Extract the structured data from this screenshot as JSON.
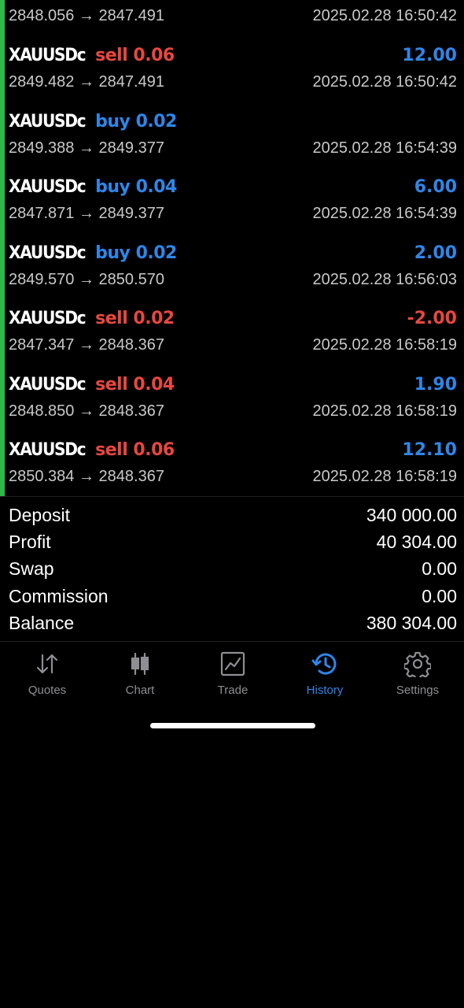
{
  "deals": [
    {
      "symbol": "",
      "side": "",
      "side_class": "",
      "volume": "",
      "profit": "",
      "profit_class": "pos",
      "open_price": "2848.056",
      "close_price": "2847.491",
      "time": "2025.02.28 16:50:42"
    },
    {
      "symbol": "XAUUSDc",
      "side": "sell",
      "side_class": "sell",
      "volume": "0.06",
      "profit": "12.00",
      "profit_class": "pos",
      "open_price": "2849.482",
      "close_price": "2847.491",
      "time": "2025.02.28 16:50:42"
    },
    {
      "symbol": "XAUUSDc",
      "side": "buy",
      "side_class": "buy",
      "volume": "0.02",
      "profit": "",
      "profit_class": "pos",
      "open_price": "2849.388",
      "close_price": "2849.377",
      "time": "2025.02.28 16:54:39"
    },
    {
      "symbol": "XAUUSDc",
      "side": "buy",
      "side_class": "buy",
      "volume": "0.04",
      "profit": "6.00",
      "profit_class": "pos",
      "open_price": "2847.871",
      "close_price": "2849.377",
      "time": "2025.02.28 16:54:39"
    },
    {
      "symbol": "XAUUSDc",
      "side": "buy",
      "side_class": "buy",
      "volume": "0.02",
      "profit": "2.00",
      "profit_class": "pos",
      "open_price": "2849.570",
      "close_price": "2850.570",
      "time": "2025.02.28 16:56:03"
    },
    {
      "symbol": "XAUUSDc",
      "side": "sell",
      "side_class": "sell",
      "volume": "0.02",
      "profit": "-2.00",
      "profit_class": "neg",
      "open_price": "2847.347",
      "close_price": "2848.367",
      "time": "2025.02.28 16:58:19"
    },
    {
      "symbol": "XAUUSDc",
      "side": "sell",
      "side_class": "sell",
      "volume": "0.04",
      "profit": "1.90",
      "profit_class": "pos",
      "open_price": "2848.850",
      "close_price": "2848.367",
      "time": "2025.02.28 16:58:19"
    },
    {
      "symbol": "XAUUSDc",
      "side": "sell",
      "side_class": "sell",
      "volume": "0.06",
      "profit": "12.10",
      "profit_class": "pos",
      "open_price": "2850.384",
      "close_price": "2848.367",
      "time": "2025.02.28 16:58:19"
    }
  ],
  "arrow": "→",
  "summary": [
    {
      "label": "Deposit",
      "value": "340 000.00"
    },
    {
      "label": "Profit",
      "value": "40 304.00"
    },
    {
      "label": "Swap",
      "value": "0.00"
    },
    {
      "label": "Commission",
      "value": "0.00"
    },
    {
      "label": "Balance",
      "value": "380 304.00"
    }
  ],
  "tabs": [
    {
      "label": "Quotes",
      "icon": "quotes-icon",
      "active": false
    },
    {
      "label": "Chart",
      "icon": "chart-icon",
      "active": false
    },
    {
      "label": "Trade",
      "icon": "trade-icon",
      "active": false
    },
    {
      "label": "History",
      "icon": "history-icon",
      "active": true
    },
    {
      "label": "Settings",
      "icon": "settings-icon",
      "active": false
    }
  ],
  "colors": {
    "buy": "#2f86e8",
    "sell": "#e8473f",
    "accent_bar": "#2fb84a",
    "active_tab": "#2f86e8",
    "inactive_tab": "#8e8e93"
  }
}
